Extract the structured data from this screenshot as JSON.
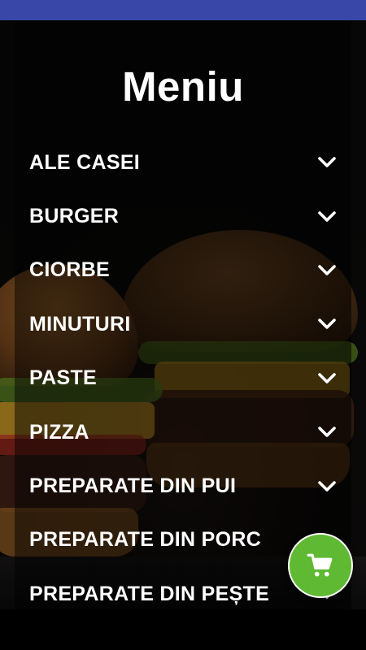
{
  "page": {
    "title": "Meniu"
  },
  "menu": {
    "items": [
      {
        "label": "ALE CASEI",
        "icon": "chevron-down-icon"
      },
      {
        "label": "BURGER",
        "icon": "chevron-down-icon"
      },
      {
        "label": "CIORBE",
        "icon": "chevron-down-icon"
      },
      {
        "label": "MINUTURI",
        "icon": "chevron-down-icon"
      },
      {
        "label": "PASTE",
        "icon": "chevron-down-icon"
      },
      {
        "label": "PIZZA",
        "icon": "chevron-down-icon"
      },
      {
        "label": "PREPARATE DIN PUI",
        "icon": "chevron-down-icon"
      },
      {
        "label": "PREPARATE DIN PORC",
        "icon": "chevron-down-icon"
      },
      {
        "label": "PREPARATE DIN PEȘTE",
        "icon": "chevron-down-icon"
      }
    ]
  },
  "cart_button": {
    "icon": "shopping-cart-icon",
    "color": "#5fb933"
  },
  "colors": {
    "status_bar": "#3947a8",
    "text": "#ffffff",
    "background": "#000000"
  }
}
